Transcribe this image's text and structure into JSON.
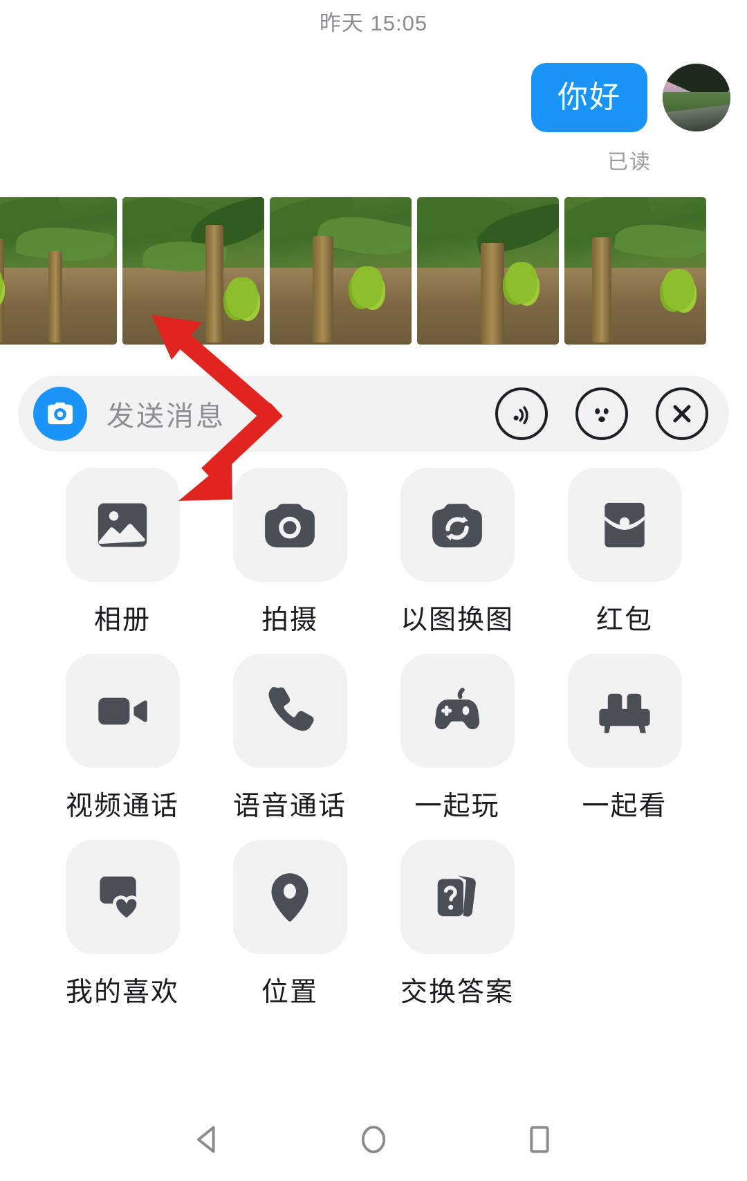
{
  "chat": {
    "timestamp": "昨天 15:05",
    "outgoing_message": "你好",
    "read_receipt": "已读",
    "avatar_name": "user-avatar"
  },
  "photo_strip": {
    "name": "photo-strip",
    "count": 5,
    "description": "banana-plantation-photos"
  },
  "input_bar": {
    "placeholder": "发送消息",
    "camera_icon": "camera-icon",
    "voice_icon": "voice-wave-icon",
    "emoji_icon": "emoji-face-icon",
    "close_icon": "close-x-icon",
    "accent_color": "#1a94f7"
  },
  "app_grid": {
    "items": [
      {
        "label": "相册",
        "icon": "photo-album-icon"
      },
      {
        "label": "拍摄",
        "icon": "camera-icon"
      },
      {
        "label": "以图换图",
        "icon": "image-swap-icon"
      },
      {
        "label": "红包",
        "icon": "red-packet-icon"
      },
      {
        "label": "视频通话",
        "icon": "video-call-icon"
      },
      {
        "label": "语音通话",
        "icon": "phone-call-icon"
      },
      {
        "label": "一起玩",
        "icon": "gamepad-icon"
      },
      {
        "label": "一起看",
        "icon": "sofa-icon"
      },
      {
        "label": "我的喜欢",
        "icon": "heart-favorite-icon"
      },
      {
        "label": "位置",
        "icon": "location-pin-icon"
      },
      {
        "label": "交换答案",
        "icon": "question-cards-icon"
      }
    ]
  },
  "navbar": {
    "back": "back-triangle-icon",
    "home": "home-circle-icon",
    "recents": "recents-square-icon"
  },
  "annotation": {
    "arrow_color": "#e0241f",
    "arrow_up_name": "annotation-arrow-to-photo-strip",
    "arrow_down_name": "annotation-arrow-to-album-tile"
  }
}
